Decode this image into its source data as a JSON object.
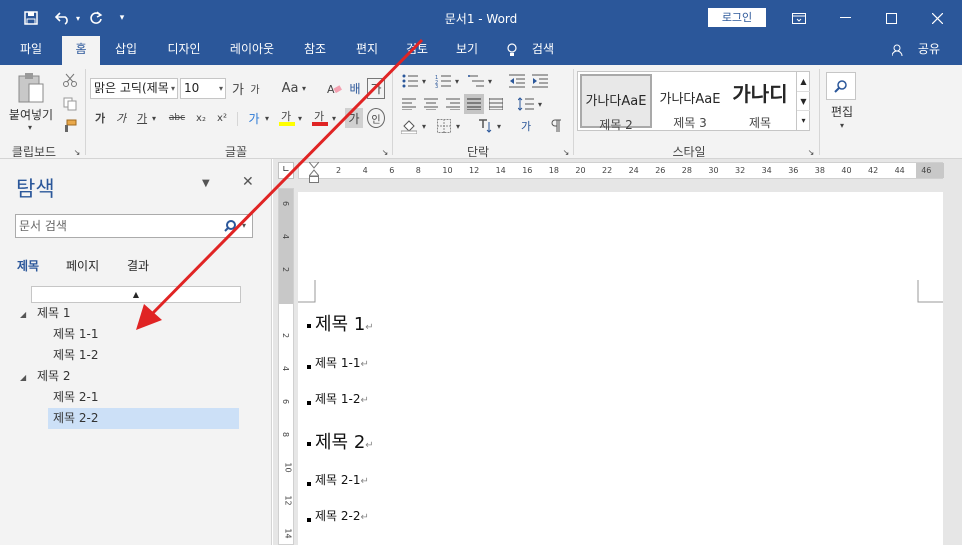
{
  "window": {
    "title": "문서1  -  Word",
    "login_label": "로그인"
  },
  "tabs": [
    "파일",
    "홈",
    "삽입",
    "디자인",
    "레이아웃",
    "참조",
    "편지",
    "검토",
    "보기",
    "검색"
  ],
  "share_label": "공유",
  "ribbon": {
    "clipboard": {
      "paste_label": "붙여넣기",
      "group": "클립보드"
    },
    "font": {
      "name": "맑은 고딕(제목",
      "size": "10",
      "group": "글꼴"
    },
    "paragraph": {
      "group": "단락"
    },
    "styles": {
      "group": "스타일",
      "items": [
        {
          "preview": "가나다AaE",
          "name": "제목 2"
        },
        {
          "preview": "가나다AaE",
          "name": "제목 3"
        },
        {
          "preview": "가나디",
          "name": "제목"
        }
      ]
    },
    "editing": {
      "label": "편집"
    }
  },
  "nav": {
    "title": "탐색",
    "search_placeholder": "문서 검색",
    "tabs": [
      "제목",
      "페이지",
      "결과"
    ],
    "tree": [
      {
        "label": "제목 1",
        "level": 1
      },
      {
        "label": "제목 1-1",
        "level": 2
      },
      {
        "label": "제목 1-2",
        "level": 2
      },
      {
        "label": "제목 2",
        "level": 1
      },
      {
        "label": "제목 2-1",
        "level": 2
      },
      {
        "label": "제목 2-2",
        "level": 2,
        "selected": true
      }
    ]
  },
  "ruler": {
    "h_ticks": [
      "2",
      "4",
      "6",
      "8",
      "10",
      "12",
      "14",
      "16",
      "18",
      "20",
      "22",
      "24",
      "26",
      "28",
      "30",
      "32",
      "34",
      "36",
      "38",
      "40",
      "42",
      "44",
      "46"
    ],
    "v_ticks": [
      "6",
      "4",
      "2",
      "",
      "2",
      "4",
      "6",
      "8",
      "10",
      "12",
      "14"
    ]
  },
  "document": {
    "paragraphs": [
      {
        "text": "제목 1",
        "style": "h1"
      },
      {
        "text": "제목 1-1",
        "style": "h2"
      },
      {
        "text": "제목 1-2",
        "style": "h2"
      },
      {
        "text": "제목 2",
        "style": "h1"
      },
      {
        "text": "제목 2-1",
        "style": "h2"
      },
      {
        "text": "제목 2-2",
        "style": "h2"
      }
    ],
    "para_mark": "↵"
  },
  "colors": {
    "brand": "#2b579a",
    "selection": "#cce0f7",
    "arrow": "#e02424"
  }
}
